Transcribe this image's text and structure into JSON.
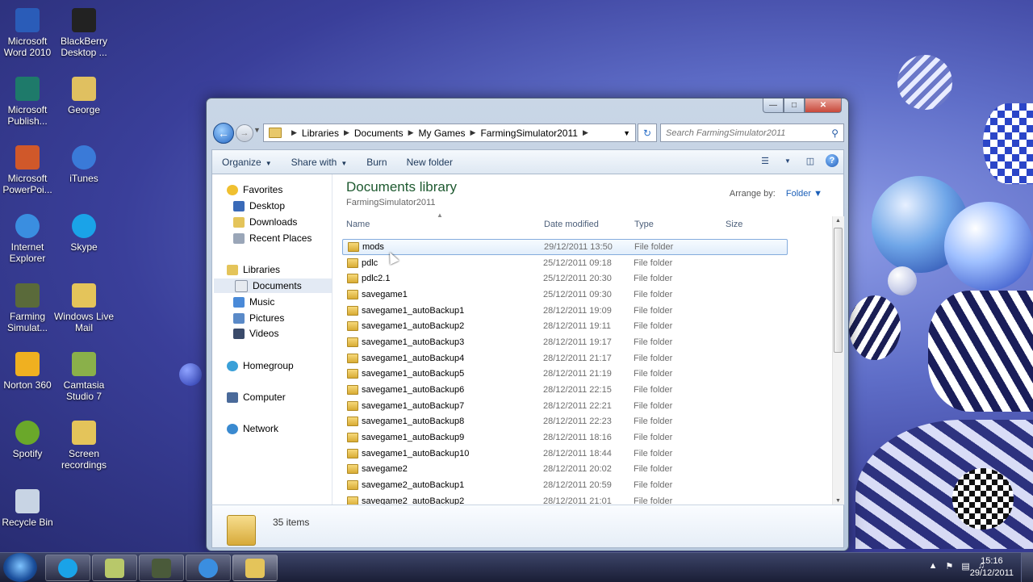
{
  "desktop": {
    "icons": [
      {
        "label": "Microsoft Word 2010",
        "icon": "word-icon",
        "color": "#2a5cb8"
      },
      {
        "label": "BlackBerry Desktop ...",
        "icon": "blackberry-icon",
        "color": "#222222"
      },
      {
        "label": "Microsoft Publish...",
        "icon": "publisher-icon",
        "color": "#1e7a6a"
      },
      {
        "label": "George",
        "icon": "user-folder-icon",
        "color": "#e0c060"
      },
      {
        "label": "Microsoft PowerPoi...",
        "icon": "powerpoint-icon",
        "color": "#d0582a"
      },
      {
        "label": "iTunes",
        "icon": "itunes-icon",
        "color": "#3a7ad8"
      },
      {
        "label": "Internet Explorer",
        "icon": "internet-explorer-icon",
        "color": "#3a8ee0"
      },
      {
        "label": "Skype",
        "icon": "skype-icon",
        "color": "#1aa3e8"
      },
      {
        "label": "Farming Simulat...",
        "icon": "farming-simulator-icon",
        "color": "#5a6a3a"
      },
      {
        "label": "Windows Live Mail",
        "icon": "mail-icon",
        "color": "#e4c45a"
      },
      {
        "label": "Norton 360",
        "icon": "norton-icon",
        "color": "#f0b020"
      },
      {
        "label": "Camtasia Studio 7",
        "icon": "camtasia-icon",
        "color": "#8ab04a"
      },
      {
        "label": "Spotify",
        "icon": "spotify-icon",
        "color": "#6aa82a"
      },
      {
        "label": "Screen recordings",
        "icon": "folder-icon",
        "color": "#e4c45a"
      },
      {
        "label": "Recycle Bin",
        "icon": "recycle-bin-icon",
        "color": "#c8d4e4"
      }
    ]
  },
  "explorer": {
    "window_controls": {
      "minimize": "—",
      "maximize": "□",
      "close": "✕"
    },
    "address": {
      "crumbs": [
        "Libraries",
        "Documents",
        "My Games",
        "FarmingSimulator2011"
      ]
    },
    "search_placeholder": "Search FarmingSimulator2011",
    "toolbar": {
      "organize": "Organize",
      "share_with": "Share with",
      "burn": "Burn",
      "new_folder": "New folder"
    },
    "nav": {
      "favorites": "Favorites",
      "desktop": "Desktop",
      "downloads": "Downloads",
      "recent_places": "Recent Places",
      "libraries": "Libraries",
      "documents": "Documents",
      "music": "Music",
      "pictures": "Pictures",
      "videos": "Videos",
      "homegroup": "Homegroup",
      "computer": "Computer",
      "network": "Network"
    },
    "library_title": "Documents library",
    "library_subtitle": "FarmingSimulator2011",
    "arrange_by_label": "Arrange by:",
    "arrange_by_value": "Folder",
    "columns": {
      "name": "Name",
      "date_modified": "Date modified",
      "type": "Type",
      "size": "Size"
    },
    "files": [
      {
        "name": "mods",
        "date": "29/12/2011 13:50",
        "type": "File folder"
      },
      {
        "name": "pdlc",
        "date": "25/12/2011 09:18",
        "type": "File folder"
      },
      {
        "name": "pdlc2.1",
        "date": "25/12/2011 20:30",
        "type": "File folder"
      },
      {
        "name": "savegame1",
        "date": "25/12/2011 09:30",
        "type": "File folder"
      },
      {
        "name": "savegame1_autoBackup1",
        "date": "28/12/2011 19:09",
        "type": "File folder"
      },
      {
        "name": "savegame1_autoBackup2",
        "date": "28/12/2011 19:11",
        "type": "File folder"
      },
      {
        "name": "savegame1_autoBackup3",
        "date": "28/12/2011 19:17",
        "type": "File folder"
      },
      {
        "name": "savegame1_autoBackup4",
        "date": "28/12/2011 21:17",
        "type": "File folder"
      },
      {
        "name": "savegame1_autoBackup5",
        "date": "28/12/2011 21:19",
        "type": "File folder"
      },
      {
        "name": "savegame1_autoBackup6",
        "date": "28/12/2011 22:15",
        "type": "File folder"
      },
      {
        "name": "savegame1_autoBackup7",
        "date": "28/12/2011 22:21",
        "type": "File folder"
      },
      {
        "name": "savegame1_autoBackup8",
        "date": "28/12/2011 22:23",
        "type": "File folder"
      },
      {
        "name": "savegame1_autoBackup9",
        "date": "28/12/2011 18:16",
        "type": "File folder"
      },
      {
        "name": "savegame1_autoBackup10",
        "date": "28/12/2011 18:44",
        "type": "File folder"
      },
      {
        "name": "savegame2",
        "date": "28/12/2011 20:02",
        "type": "File folder"
      },
      {
        "name": "savegame2_autoBackup1",
        "date": "28/12/2011 20:59",
        "type": "File folder"
      },
      {
        "name": "savegame2_autoBackup2",
        "date": "28/12/2011 21:01",
        "type": "File folder"
      }
    ],
    "item_count": "35 items"
  },
  "taskbar": {
    "apps": [
      "skype-icon",
      "notes-icon",
      "farming-simulator-icon",
      "internet-explorer-icon",
      "explorer-icon"
    ],
    "time": "15:16",
    "date": "29/12/2011"
  }
}
